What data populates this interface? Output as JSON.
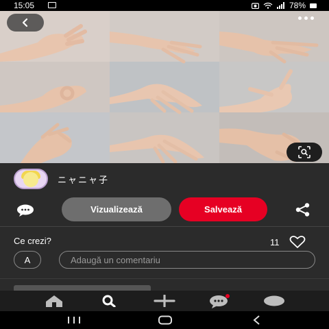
{
  "status_bar": {
    "time": "15:05",
    "battery_text": "78%",
    "icons": [
      "image-icon",
      "camera-icon",
      "wifi-icon",
      "signal-icon",
      "battery-icon"
    ]
  },
  "pin": {
    "background_color": "#cfcac7",
    "icons": [
      "back-arrow-icon",
      "more-dots-icon",
      "visual-search-icon"
    ]
  },
  "profile": {
    "name": "ニャニャ子",
    "avatar_icon": "anime-avatar"
  },
  "actions": {
    "view_label": "Vizualizează",
    "save_label": "Salvează",
    "comment_icon": "comment-bubble-icon",
    "share_icon": "share-icon",
    "save_color": "#e60023",
    "view_color": "#6e6e6e"
  },
  "comments": {
    "prompt": "Ce crezi?",
    "like_count": "11",
    "user_initial": "A",
    "input_placeholder": "Adaugă un comentariu"
  },
  "bottom_nav": {
    "items": [
      "home-icon",
      "search-icon",
      "create-plus-icon",
      "messages-icon",
      "profile-icon"
    ],
    "active": "search-icon",
    "notification_color": "#e60023"
  },
  "system_nav": {
    "items": [
      "recents-icon",
      "home-circle-icon",
      "back-chevron-icon"
    ]
  }
}
